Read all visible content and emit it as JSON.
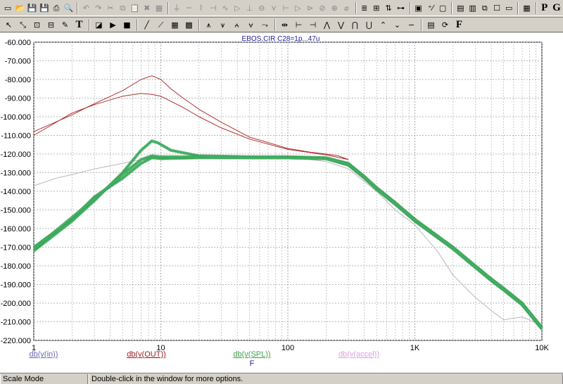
{
  "toolbar_top": {
    "buttons": [
      {
        "name": "new-file-icon",
        "glyph": "▭",
        "dim": false
      },
      {
        "name": "open-folder-icon",
        "glyph": "📂",
        "dim": false
      },
      {
        "name": "save-icon",
        "glyph": "💾",
        "dim": false
      },
      {
        "name": "save-all-icon",
        "glyph": "💾",
        "dim": false
      },
      {
        "name": "print-icon",
        "glyph": "⎙",
        "dim": false
      },
      {
        "name": "print-preview-icon",
        "glyph": "🔍",
        "dim": false
      },
      {
        "sep": true
      },
      {
        "name": "undo-icon",
        "glyph": "↶",
        "dim": true
      },
      {
        "name": "redo-icon",
        "glyph": "↷",
        "dim": true
      },
      {
        "name": "cut-icon",
        "glyph": "✂",
        "dim": true
      },
      {
        "name": "copy-icon",
        "glyph": "⧉",
        "dim": true
      },
      {
        "name": "paste-icon",
        "glyph": "📋",
        "dim": false
      },
      {
        "name": "delete-icon",
        "glyph": "✖",
        "dim": true
      },
      {
        "name": "select-all-icon",
        "glyph": "▦",
        "dim": true
      },
      {
        "sep": true
      },
      {
        "name": "ground-icon",
        "glyph": "⏚",
        "dim": true
      },
      {
        "name": "wire-icon",
        "glyph": "─",
        "dim": true
      },
      {
        "name": "resistor-icon",
        "glyph": "⌇",
        "dim": true
      },
      {
        "name": "capacitor-icon",
        "glyph": "⊣",
        "dim": true
      },
      {
        "name": "inductor-icon",
        "glyph": "∿",
        "dim": true
      },
      {
        "name": "diode-icon",
        "glyph": "▷",
        "dim": true
      },
      {
        "name": "battery-icon",
        "glyph": "⊥",
        "dim": true
      },
      {
        "name": "source-icon",
        "glyph": "⊖",
        "dim": true
      },
      {
        "name": "transistor-icon",
        "glyph": "⋎",
        "dim": true
      },
      {
        "name": "mosfet-icon",
        "glyph": "⊢",
        "dim": true
      },
      {
        "name": "opamp-icon",
        "glyph": "▷",
        "dim": true
      },
      {
        "name": "gate-icon",
        "glyph": "⊳",
        "dim": true
      },
      {
        "name": "ac-source-icon",
        "glyph": "⊘",
        "dim": true
      },
      {
        "name": "dc-source-icon",
        "glyph": "⊕",
        "dim": true
      },
      {
        "name": "switch-icon",
        "glyph": "⌀",
        "dim": true
      },
      {
        "sep": true
      },
      {
        "name": "text-mode-icon",
        "glyph": "≣",
        "dim": false
      },
      {
        "name": "grid-text-icon",
        "glyph": "⊞",
        "dim": false
      },
      {
        "name": "node-numbers-icon",
        "glyph": "⇅",
        "dim": false
      },
      {
        "name": "pin-connections-icon",
        "glyph": "⊶",
        "dim": false
      },
      {
        "sep": true
      },
      {
        "name": "component-editor-icon",
        "glyph": "▣",
        "dim": false
      },
      {
        "name": "node-voltages-icon",
        "glyph": "⁺⁄",
        "dim": false
      },
      {
        "name": "window-icon",
        "glyph": "▢",
        "dim": false
      },
      {
        "sep": true
      },
      {
        "name": "tile-horizontal-icon",
        "glyph": "▤",
        "dim": false
      },
      {
        "name": "tile-vertical-icon",
        "glyph": "▥",
        "dim": false
      },
      {
        "name": "cascade-icon",
        "glyph": "⧉",
        "dim": false
      },
      {
        "name": "maximize-icon",
        "glyph": "☐",
        "dim": false
      },
      {
        "name": "restore-icon",
        "glyph": "▭",
        "dim": false
      },
      {
        "sep": true
      },
      {
        "name": "calculator-icon",
        "glyph": "▦",
        "dim": false
      },
      {
        "sep": true
      },
      {
        "name": "probe-p-icon",
        "glyph": "P",
        "dim": false,
        "letter": true
      },
      {
        "name": "probe-g-icon",
        "glyph": "G",
        "dim": false,
        "letter": true
      }
    ]
  },
  "toolbar_bottom": {
    "buttons": [
      {
        "name": "select-mode-icon",
        "glyph": "↖",
        "dim": false
      },
      {
        "name": "scale-mode-icon",
        "glyph": "⤡",
        "dim": false
      },
      {
        "name": "zoom-box-icon",
        "glyph": "⊡",
        "dim": false
      },
      {
        "name": "pan-icon",
        "glyph": "⊟",
        "dim": false
      },
      {
        "name": "draw-tool-icon",
        "glyph": "✎",
        "dim": false
      },
      {
        "name": "text-tool-icon",
        "glyph": "T",
        "dim": false,
        "letter": true
      },
      {
        "sep": true
      },
      {
        "name": "properties-icon",
        "glyph": "◪",
        "dim": false
      },
      {
        "name": "run-icon",
        "glyph": "▶",
        "dim": false
      },
      {
        "name": "stop-icon",
        "glyph": "■",
        "dim": false
      },
      {
        "sep": true
      },
      {
        "name": "line-tool-icon",
        "glyph": "╱",
        "dim": false
      },
      {
        "name": "polyline-tool-icon",
        "glyph": "⟋",
        "dim": false
      },
      {
        "name": "grid-icon",
        "glyph": "▦",
        "dim": false
      },
      {
        "name": "minor-grid-icon",
        "glyph": "▩",
        "dim": false
      },
      {
        "sep": true
      },
      {
        "name": "peak-cursor-icon",
        "glyph": "⩚",
        "dim": false
      },
      {
        "name": "valley-cursor-icon",
        "glyph": "⩛",
        "dim": false
      },
      {
        "name": "high-cursor-icon",
        "glyph": "⩜",
        "dim": false
      },
      {
        "name": "low-cursor-icon",
        "glyph": "⩝",
        "dim": false
      },
      {
        "name": "slope-cursor-icon",
        "glyph": "⤳",
        "dim": false
      },
      {
        "sep": true
      },
      {
        "name": "next-simulation-icon",
        "glyph": "⇹",
        "dim": false
      },
      {
        "name": "cursor-left-icon",
        "glyph": "⊢",
        "dim": false
      },
      {
        "name": "cursor-right-icon",
        "glyph": "⊣",
        "dim": false
      },
      {
        "name": "peak-mark-icon",
        "glyph": "⋀",
        "dim": false
      },
      {
        "name": "valley-mark-icon",
        "glyph": "⋁",
        "dim": false
      },
      {
        "name": "local-peak-icon",
        "glyph": "⋂",
        "dim": false
      },
      {
        "name": "local-valley-icon",
        "glyph": "⋃",
        "dim": false
      },
      {
        "name": "global-high-icon",
        "glyph": "⌃",
        "dim": false
      },
      {
        "name": "global-low-icon",
        "glyph": "⌄",
        "dim": false
      },
      {
        "name": "inflection-icon",
        "glyph": "∽",
        "dim": false
      },
      {
        "sep": true
      },
      {
        "name": "data-table-icon",
        "glyph": "▤",
        "dim": false
      },
      {
        "name": "stepping-icon",
        "glyph": "⟳",
        "dim": false
      },
      {
        "name": "fourier-icon",
        "glyph": "F",
        "dim": false,
        "letter": true
      }
    ]
  },
  "chart_data": {
    "type": "line",
    "title": "EBOS.CIR C28=1p...47u",
    "xlabel": "F",
    "x_scale": "log",
    "xlim": [
      1,
      10000
    ],
    "ylim": [
      -220,
      -60
    ],
    "x_ticks": [
      {
        "value": 1,
        "label": "1"
      },
      {
        "value": 10,
        "label": "10"
      },
      {
        "value": 100,
        "label": "100"
      },
      {
        "value": 1000,
        "label": "1K"
      },
      {
        "value": 10000,
        "label": "10K"
      }
    ],
    "y_ticks": [
      {
        "value": -60,
        "label": "-60.000"
      },
      {
        "value": -70,
        "label": "-70.000"
      },
      {
        "value": -80,
        "label": "-80.000"
      },
      {
        "value": -90,
        "label": "-90.000"
      },
      {
        "value": -100,
        "label": "-100.000"
      },
      {
        "value": -110,
        "label": "-110.000"
      },
      {
        "value": -120,
        "label": "-120.000"
      },
      {
        "value": -130,
        "label": "-130.000"
      },
      {
        "value": -140,
        "label": "-140.000"
      },
      {
        "value": -150,
        "label": "-150.000"
      },
      {
        "value": -160,
        "label": "-160.000"
      },
      {
        "value": -170,
        "label": "-170.000"
      },
      {
        "value": -180,
        "label": "-180.000"
      },
      {
        "value": -190,
        "label": "-190.000"
      },
      {
        "value": -200,
        "label": "-200.000"
      },
      {
        "value": -210,
        "label": "-210.000"
      },
      {
        "value": -220,
        "label": "-220.000"
      }
    ],
    "grid": true,
    "legend_placement": "bottom",
    "series": [
      {
        "name": "db(v(in))",
        "color": "#8080c0",
        "legend_color": "#6a6ab0",
        "width": 1,
        "curves": [
          {
            "color": "#b8b8b8",
            "points": [
              [
                1,
                -137
              ],
              [
                1.5,
                -133
              ],
              [
                2,
                -131
              ],
              [
                3,
                -128
              ],
              [
                5,
                -125
              ],
              [
                7,
                -123
              ],
              [
                10,
                -121.5
              ],
              [
                20,
                -121
              ],
              [
                50,
                -121.5
              ],
              [
                100,
                -122
              ],
              [
                150,
                -123
              ],
              [
                200,
                -124
              ],
              [
                300,
                -128
              ],
              [
                500,
                -140
              ],
              [
                700,
                -150
              ],
              [
                1000,
                -158
              ],
              [
                1500,
                -172
              ],
              [
                2000,
                -185
              ],
              [
                3000,
                -197
              ],
              [
                4000,
                -204
              ],
              [
                5000,
                -209
              ],
              [
                6000,
                -208
              ],
              [
                7000,
                -207.5
              ],
              [
                8000,
                -209
              ],
              [
                10000,
                -212
              ]
            ]
          }
        ]
      },
      {
        "name": "db(v(OUT))",
        "color": "#b03030",
        "legend_color": "#a02020",
        "width": 1,
        "curves": [
          {
            "points": [
              [
                1,
                -108
              ],
              [
                2,
                -99
              ],
              [
                3,
                -93
              ],
              [
                5,
                -86
              ],
              [
                7,
                -80
              ],
              [
                8.5,
                -78
              ],
              [
                10,
                -80
              ],
              [
                12,
                -85
              ],
              [
                15,
                -90
              ],
              [
                20,
                -96
              ],
              [
                30,
                -103
              ],
              [
                50,
                -111
              ],
              [
                80,
                -115
              ],
              [
                100,
                -117
              ],
              [
                150,
                -119
              ],
              [
                200,
                -120
              ],
              [
                250,
                -121
              ],
              [
                300,
                -123
              ]
            ]
          },
          {
            "points": [
              [
                1,
                -110
              ],
              [
                2,
                -98
              ],
              [
                3,
                -93.5
              ],
              [
                5,
                -89
              ],
              [
                7,
                -87.5
              ],
              [
                8.5,
                -88
              ],
              [
                10,
                -89
              ],
              [
                15,
                -95
              ],
              [
                20,
                -100
              ],
              [
                30,
                -106
              ],
              [
                50,
                -112
              ],
              [
                100,
                -117.5
              ],
              [
                200,
                -120.5
              ],
              [
                300,
                -123
              ]
            ]
          }
        ]
      },
      {
        "name": "db(v(SPL))",
        "color": "#40b060",
        "legend_color": "#40a050",
        "width": 3,
        "curves": [
          {
            "points": [
              [
                1,
                -170
              ],
              [
                2,
                -155
              ],
              [
                3,
                -143
              ],
              [
                5,
                -133
              ],
              [
                7,
                -125
              ],
              [
                8.5,
                -122
              ],
              [
                10,
                -122.5
              ],
              [
                20,
                -122
              ],
              [
                50,
                -122
              ],
              [
                100,
                -122
              ],
              [
                200,
                -122.5
              ],
              [
                300,
                -126
              ],
              [
                400,
                -133
              ],
              [
                500,
                -139
              ],
              [
                700,
                -147
              ],
              [
                1000,
                -156
              ],
              [
                2000,
                -171
              ],
              [
                3000,
                -181
              ],
              [
                4000,
                -188
              ],
              [
                5000,
                -193
              ],
              [
                7000,
                -201
              ],
              [
                10000,
                -214
              ]
            ]
          },
          {
            "points": [
              [
                1,
                -172
              ],
              [
                2,
                -156
              ],
              [
                3,
                -145
              ],
              [
                5,
                -130
              ],
              [
                7,
                -118
              ],
              [
                8.5,
                -113
              ],
              [
                9.5,
                -114
              ],
              [
                12,
                -118
              ],
              [
                20,
                -121
              ],
              [
                50,
                -121.5
              ],
              [
                100,
                -121.5
              ],
              [
                200,
                -122
              ],
              [
                300,
                -125
              ],
              [
                400,
                -132
              ],
              [
                500,
                -138
              ],
              [
                700,
                -146
              ],
              [
                1000,
                -155
              ],
              [
                2000,
                -170
              ],
              [
                3000,
                -180
              ],
              [
                4000,
                -187
              ],
              [
                5000,
                -192
              ],
              [
                7000,
                -200
              ],
              [
                10000,
                -213
              ]
            ]
          },
          {
            "points": [
              [
                1,
                -171
              ],
              [
                2,
                -154
              ],
              [
                3,
                -144
              ],
              [
                5,
                -131
              ],
              [
                7,
                -123
              ],
              [
                8.5,
                -121
              ],
              [
                10,
                -121.5
              ],
              [
                20,
                -121.5
              ],
              [
                50,
                -122
              ],
              [
                100,
                -122
              ],
              [
                200,
                -122.5
              ],
              [
                300,
                -125.5
              ],
              [
                400,
                -132.5
              ],
              [
                500,
                -138.5
              ],
              [
                700,
                -146.5
              ],
              [
                1000,
                -155.5
              ],
              [
                2000,
                -170.5
              ],
              [
                3000,
                -180.5
              ],
              [
                4000,
                -187.5
              ],
              [
                5000,
                -192.5
              ],
              [
                7000,
                -200.5
              ],
              [
                10000,
                -213.5
              ]
            ]
          }
        ]
      },
      {
        "name": "db(v(accel))",
        "color": "#e090e0",
        "legend_color": "#e0a0e0",
        "width": 1,
        "curves": []
      }
    ]
  },
  "status": {
    "mode": "Scale Mode",
    "hint": "Double-click in the window for more options."
  }
}
